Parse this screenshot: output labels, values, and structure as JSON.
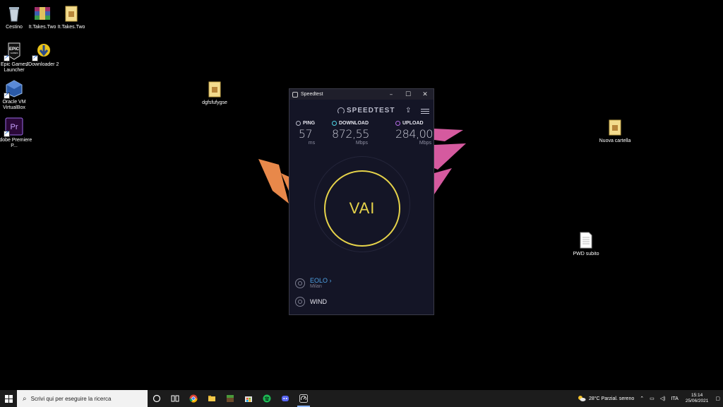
{
  "desktop": {
    "icons": [
      {
        "label": "Cestino",
        "icon": "recycle-bin-icon"
      },
      {
        "label": "It.Takes.Two",
        "icon": "winrar-archive-icon"
      },
      {
        "label": "It.Takes.Two",
        "icon": "folder-icon"
      },
      {
        "label": "Epic Games Launcher",
        "icon": "epic-games-icon"
      },
      {
        "label": "JDownloader 2",
        "icon": "jdownloader-icon"
      },
      {
        "label": "Oracle VM VirtualBox",
        "icon": "virtualbox-icon"
      },
      {
        "label": "Adobe Premiere P...",
        "icon": "premiere-icon"
      },
      {
        "label": "dgfsfufygse",
        "icon": "folder-icon"
      },
      {
        "label": "Nuova cartella",
        "icon": "folder-icon"
      },
      {
        "label": "PWD subito",
        "icon": "text-file-icon"
      }
    ]
  },
  "speedtest": {
    "window_title": "Speedtest",
    "brand": "SPEEDTEST",
    "ping": {
      "label": "PING",
      "value": "57",
      "unit": "ms"
    },
    "download": {
      "label": "DOWNLOAD",
      "value": "872,55",
      "unit": "Mbps"
    },
    "upload": {
      "label": "UPLOAD",
      "value": "284,00",
      "unit": "Mbps"
    },
    "go_label": "VAI",
    "server": {
      "name": "EOLO",
      "chevron": "›",
      "location": "Milan"
    },
    "connection": {
      "name": "WIND"
    }
  },
  "taskbar": {
    "search_placeholder": "Scrivi qui per eseguire la ricerca",
    "weather": "28°C  Parzial. sereno",
    "language": "ITA",
    "time": "15:14",
    "date": "25/06/2021"
  },
  "colors": {
    "accent_go": "#e6d34a",
    "ping_icon": "#b8b9c9",
    "download_icon": "#4fd6e6",
    "upload_icon": "#b56be6",
    "server_link": "#4fa3e6"
  }
}
